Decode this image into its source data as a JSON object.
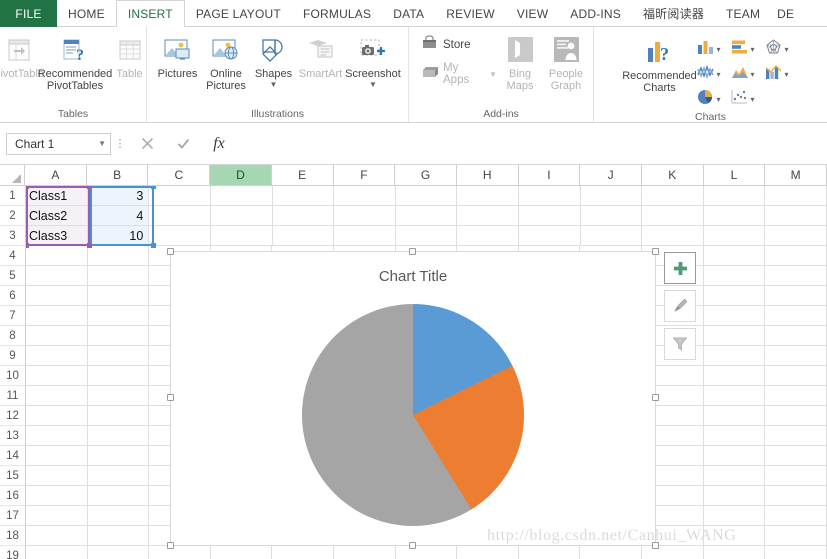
{
  "app": {
    "name": "Microsoft Excel 2013"
  },
  "tabs": [
    {
      "label": "FILE",
      "kind": "file"
    },
    {
      "label": "HOME",
      "kind": "normal"
    },
    {
      "label": "INSERT",
      "kind": "active"
    },
    {
      "label": "PAGE LAYOUT",
      "kind": "normal"
    },
    {
      "label": "FORMULAS",
      "kind": "normal"
    },
    {
      "label": "DATA",
      "kind": "normal"
    },
    {
      "label": "REVIEW",
      "kind": "normal"
    },
    {
      "label": "VIEW",
      "kind": "normal"
    },
    {
      "label": "ADD-INS",
      "kind": "normal"
    },
    {
      "label": "福昕阅读器",
      "kind": "normal"
    },
    {
      "label": "TEAM",
      "kind": "normal"
    },
    {
      "label": "DE",
      "kind": "cut"
    }
  ],
  "ribbon": {
    "groups": [
      {
        "label": "Tables",
        "buttons": [
          {
            "label": "PivotTable",
            "icon": "pivottable-icon",
            "enabled": false,
            "caret": false
          },
          {
            "label": "Recommended PivotTables",
            "icon": "recommended-pivottables-icon",
            "enabled": true,
            "caret": false
          },
          {
            "label": "Table",
            "icon": "table-icon",
            "enabled": false,
            "caret": false
          }
        ]
      },
      {
        "label": "Illustrations",
        "buttons": [
          {
            "label": "Pictures",
            "icon": "pictures-icon",
            "enabled": true,
            "caret": false
          },
          {
            "label": "Online Pictures",
            "icon": "online-pictures-icon",
            "enabled": true,
            "caret": false
          },
          {
            "label": "Shapes",
            "icon": "shapes-icon",
            "enabled": true,
            "caret": true
          },
          {
            "label": "SmartArt",
            "icon": "smartart-icon",
            "enabled": false,
            "caret": false
          },
          {
            "label": "Screenshot",
            "icon": "screenshot-icon",
            "enabled": true,
            "caret": true
          }
        ]
      },
      {
        "label": "Add-ins",
        "small_buttons": [
          {
            "label": "Store",
            "icon": "store-icon",
            "enabled": true,
            "caret": false
          },
          {
            "label": "My Apps",
            "icon": "my-apps-icon",
            "enabled": false,
            "caret": true
          }
        ],
        "buttons": [
          {
            "label": "Bing Maps",
            "icon": "bing-maps-icon",
            "enabled": false,
            "caret": false
          },
          {
            "label": "People Graph",
            "icon": "people-graph-icon",
            "enabled": false,
            "caret": false
          }
        ]
      },
      {
        "label": "Charts",
        "buttons": [
          {
            "label": "Recommended Charts",
            "icon": "recommended-charts-icon",
            "enabled": true,
            "caret": false
          }
        ],
        "chart_types": [
          {
            "icon": "column-chart-icon",
            "name": "insert-column-chart"
          },
          {
            "icon": "bar-chart-icon",
            "name": "insert-bar-chart"
          },
          {
            "icon": "radar-chart-icon",
            "name": "insert-radar-chart"
          },
          {
            "icon": "line-chart-icon",
            "name": "insert-line-chart"
          },
          {
            "icon": "area-chart-icon",
            "name": "insert-area-chart"
          },
          {
            "icon": "combo-chart-icon",
            "name": "insert-combo-chart"
          },
          {
            "icon": "pie-chart-icon",
            "name": "insert-pie-chart"
          },
          {
            "icon": "scatter-chart-icon",
            "name": "insert-scatter-chart"
          }
        ]
      }
    ]
  },
  "formula_bar": {
    "name_box_value": "Chart 1",
    "formula_value": "",
    "formula_placeholder": "",
    "cancel_label": "✕",
    "enter_label": "✓",
    "function_label": "fx"
  },
  "grid": {
    "columns": [
      "A",
      "B",
      "C",
      "D",
      "E",
      "F",
      "G",
      "H",
      "I",
      "J",
      "K",
      "L",
      "M"
    ],
    "selected_column": "D",
    "rows": [
      "1",
      "2",
      "3",
      "4",
      "5",
      "6",
      "7",
      "8",
      "9",
      "10",
      "11",
      "12",
      "13",
      "14",
      "15",
      "16",
      "17",
      "18",
      "19"
    ],
    "cells": [
      {
        "row": 1,
        "a": "Class1",
        "b": "3"
      },
      {
        "row": 2,
        "a": "Class2",
        "b": "4"
      },
      {
        "row": 3,
        "a": "Class3",
        "b": "10"
      }
    ],
    "selection_colors": {
      "category_range": "#9c5cb0",
      "value_range": "#4a90d9"
    }
  },
  "chart": {
    "title": "Chart Title",
    "side_buttons": [
      {
        "name": "chart-elements-button",
        "icon": "plus-icon",
        "color": "#4e9a7a"
      },
      {
        "name": "chart-styles-button",
        "icon": "paintbrush-icon",
        "color": "#7f7f7f"
      },
      {
        "name": "chart-filters-button",
        "icon": "funnel-icon",
        "color": "#9a9a9a"
      }
    ]
  },
  "chart_data": {
    "type": "pie",
    "title": "Chart Title",
    "categories": [
      "Class1",
      "Class2",
      "Class3"
    ],
    "values": [
      3,
      4,
      10
    ],
    "percentages": [
      17.6,
      23.5,
      58.8
    ],
    "colors": [
      "#5b9bd5",
      "#ed7d31",
      "#a5a5a5"
    ],
    "legend": "none",
    "data_labels": false,
    "start_angle": 0
  },
  "watermark": {
    "text": "http://blog.csdn.net/Canhui_WANG"
  }
}
